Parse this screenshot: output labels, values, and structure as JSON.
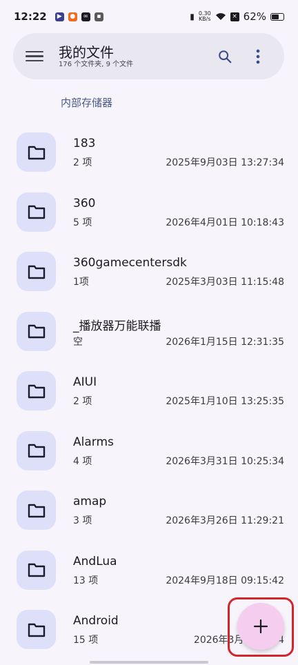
{
  "status_bar": {
    "time": "12:22",
    "net_speed_value": "0.30",
    "net_speed_unit": "KB/s",
    "battery_percent": "62%",
    "battery_level": 0.62
  },
  "header": {
    "title": "我的文件",
    "subtitle": "176 个文件夹, 9 个文件"
  },
  "breadcrumb": "内部存储器",
  "files": [
    {
      "name": "183",
      "count": "2 项",
      "date": "2025年9月03日 13:27:34"
    },
    {
      "name": "360",
      "count": "5 项",
      "date": "2026年4月01日 10:18:43"
    },
    {
      "name": "360gamecentersdk",
      "count": "1项",
      "date": "2025年3月03日 11:15:48"
    },
    {
      "name": "_播放器万能联播",
      "count": "空",
      "date": "2026年1月15日 12:31:35"
    },
    {
      "name": "AIUI",
      "count": "2 项",
      "date": "2025年1月10日 13:25:35"
    },
    {
      "name": "Alarms",
      "count": "4 项",
      "date": "2026年3月31日 10:25:34"
    },
    {
      "name": "amap",
      "count": "3 项",
      "date": "2026年3月26日 11:29:21"
    },
    {
      "name": "AndLua",
      "count": "13 项",
      "date": "2024年9月18日 09:15:42"
    },
    {
      "name": "Android",
      "count": "15 项",
      "date": "2026年3月31日 1 4"
    }
  ],
  "colors": {
    "background": "#f7f5fb",
    "folder_tile": "#dde0f8",
    "fab": "#f5cdef",
    "highlight": "#d2262b"
  },
  "icons": {
    "menu": "menu-icon",
    "search": "search-icon",
    "more": "more-vert-icon",
    "folder": "folder-icon",
    "add": "plus-icon"
  }
}
